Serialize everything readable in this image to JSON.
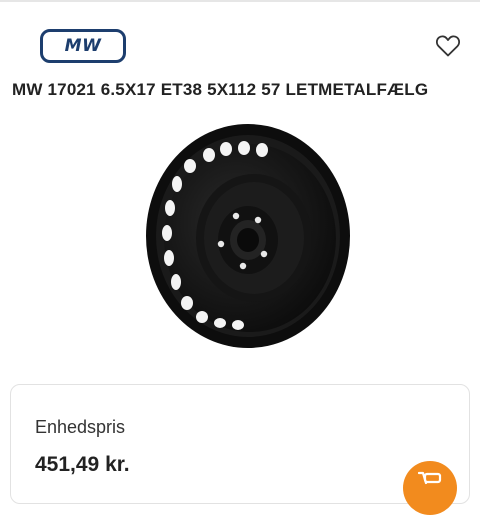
{
  "header": {
    "logo_text": "MW",
    "wishlist_icon": "heart-outline-icon",
    "brand_color": "#1d3e6e"
  },
  "product": {
    "title": "MW 17021 6.5X17 ET38 5X112 57 LETMETALFÆLG",
    "image_alt": "Black steel wheel rim"
  },
  "price": {
    "label": "Enhedspris",
    "value": "451,49 kr."
  },
  "cart": {
    "icon": "cart-icon",
    "accent_color": "#f28b1e"
  }
}
